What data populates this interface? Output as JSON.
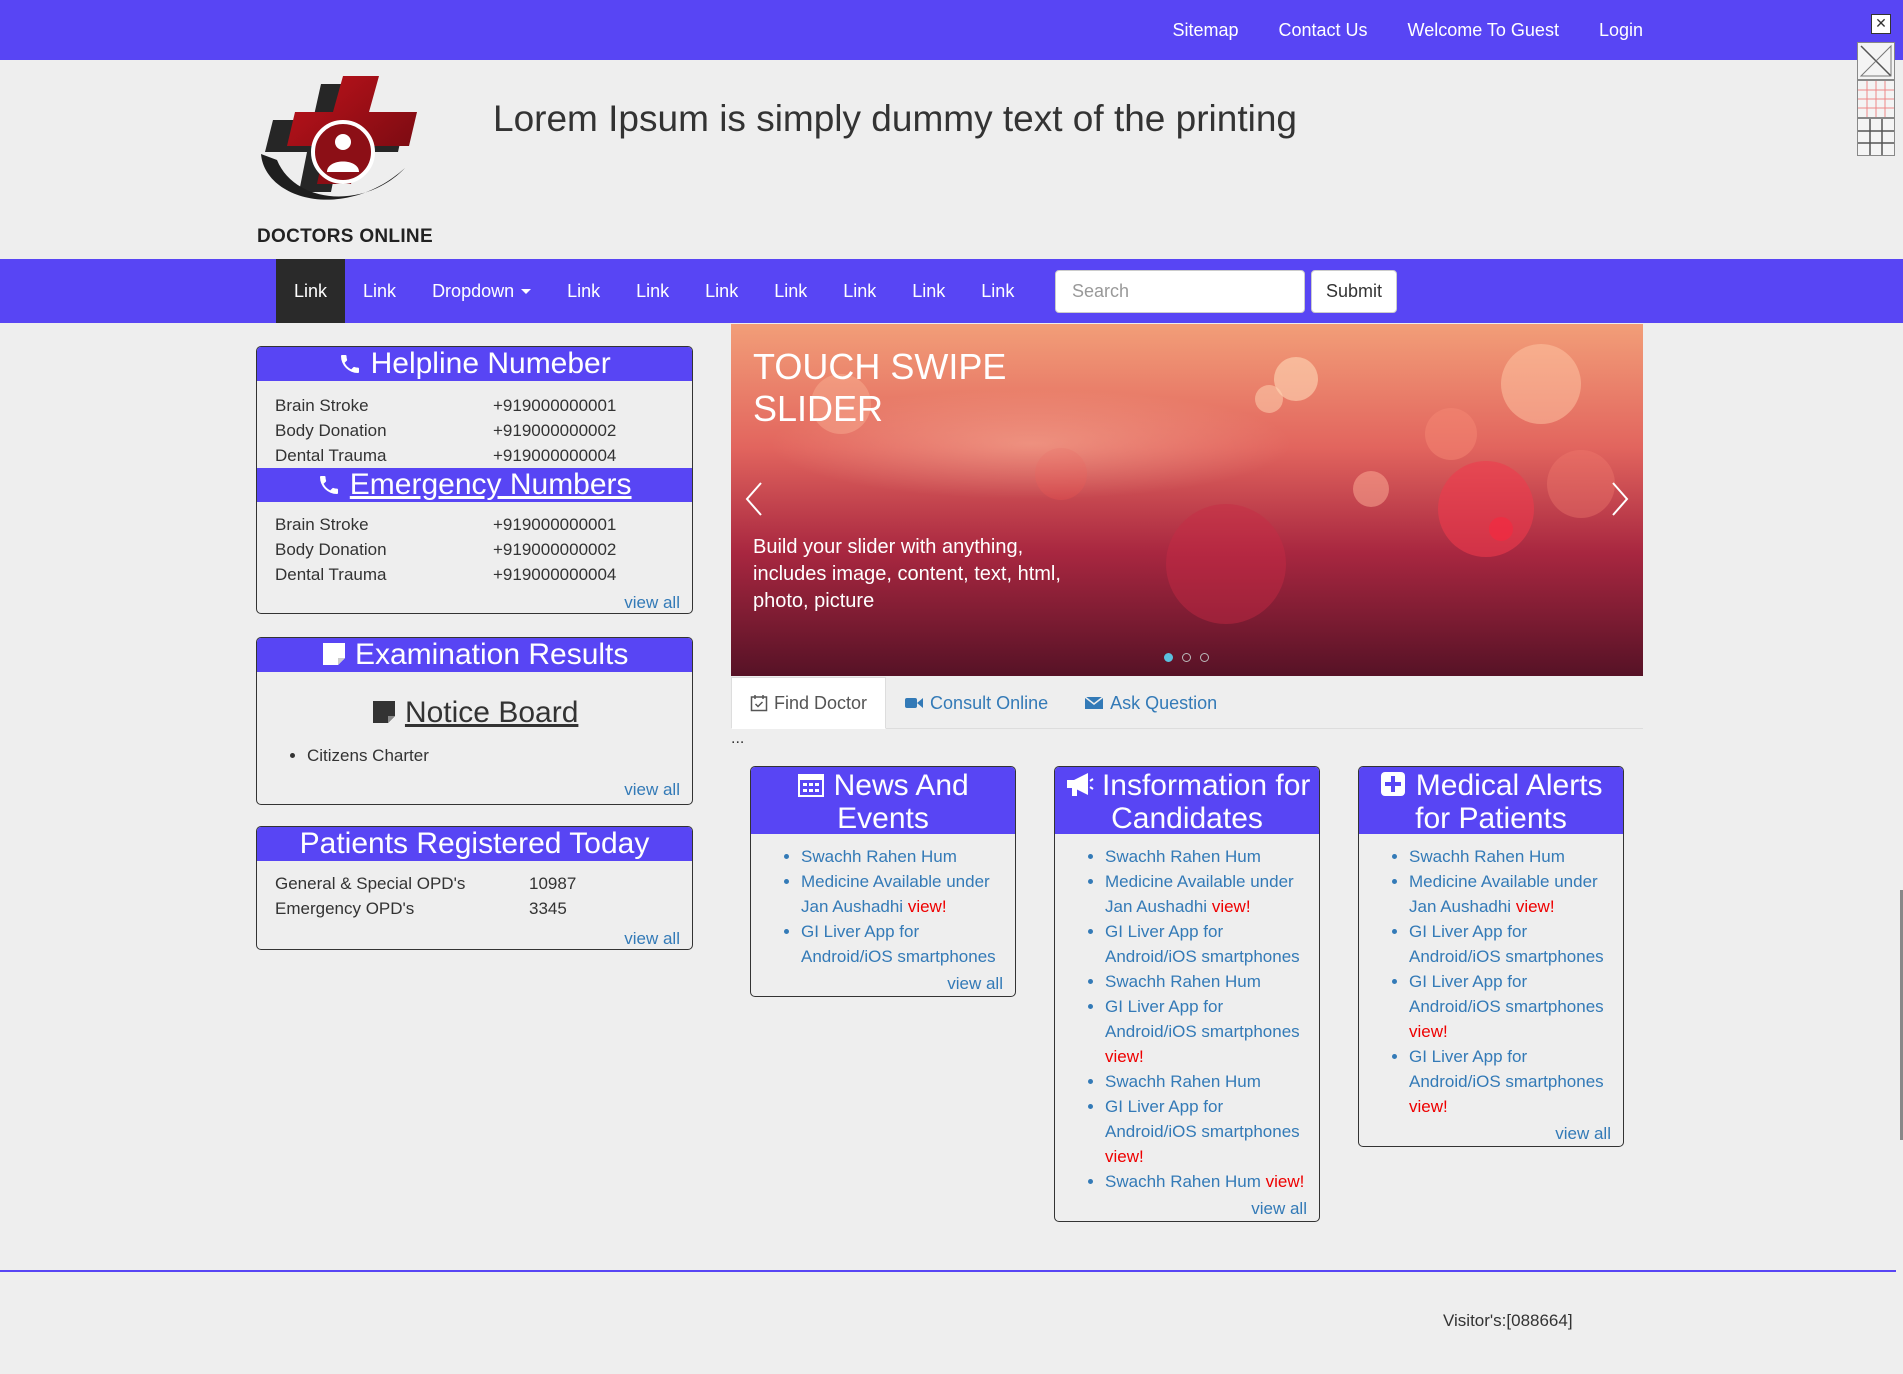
{
  "topbar": {
    "links": [
      "Sitemap",
      "Contact Us",
      "Welcome To Guest",
      "Login"
    ]
  },
  "header": {
    "logo_text": "DOCTORS ONLINE",
    "tagline": "Lorem Ipsum is simply dummy text of the printing"
  },
  "nav": {
    "items": [
      "Link",
      "Link",
      "Dropdown",
      "Link",
      "Link",
      "Link",
      "Link",
      "Link",
      "Link",
      "Link"
    ],
    "search_placeholder": "Search",
    "submit_label": "Submit"
  },
  "helpline": {
    "title": "Helpline Numeber",
    "rows": [
      {
        "name": "Brain Stroke",
        "number": "+919000000001"
      },
      {
        "name": "Body Donation",
        "number": "+919000000002"
      },
      {
        "name": "Dental Trauma",
        "number": "+919000000004"
      }
    ],
    "emergency_title": "Emergency Numbers",
    "emergency_rows": [
      {
        "name": "Brain Stroke",
        "number": "+919000000001"
      },
      {
        "name": "Body Donation",
        "number": "+919000000002"
      },
      {
        "name": "Dental Trauma",
        "number": "+919000000004"
      }
    ],
    "view_all": "view all"
  },
  "exam": {
    "title": "Examination Results",
    "notice_title": "Notice Board",
    "items": [
      "Citizens Charter"
    ],
    "view_all": "view all"
  },
  "patients": {
    "title": "Patients Registered Today",
    "rows": [
      {
        "name": "General & Special OPD's",
        "count": "10987"
      },
      {
        "name": "Emergency OPD's",
        "count": "3345"
      }
    ],
    "view_all": "view all"
  },
  "slider": {
    "title": "TOUCH SWIPE SLIDER",
    "text": "Build your slider with anything, includes image, content, text, html, photo, picture",
    "slide_count": 3,
    "active_slide": 1
  },
  "tabs": {
    "items": [
      "Find Doctor",
      "Consult Online",
      "Ask Question"
    ],
    "after": "..."
  },
  "news": {
    "title": "News And Events",
    "items": [
      {
        "text": "Swachh Rahen Hum",
        "view": ""
      },
      {
        "text": "Medicine Available under Jan Aushadhi",
        "view": "view!"
      },
      {
        "text": "GI Liver App for Android/iOS smartphones",
        "view": ""
      }
    ],
    "view_all": "view all"
  },
  "info": {
    "title": "Insformation for Candidates",
    "items": [
      {
        "text": "Swachh Rahen Hum",
        "view": ""
      },
      {
        "text": "Medicine Available under Jan Aushadhi",
        "view": "view!"
      },
      {
        "text": "GI Liver App for Android/iOS smartphones",
        "view": ""
      },
      {
        "text": "Swachh Rahen Hum",
        "view": ""
      },
      {
        "text": "GI Liver App for Android/iOS smartphones",
        "view": "view!"
      },
      {
        "text": "Swachh Rahen Hum",
        "view": ""
      },
      {
        "text": "GI Liver App for Android/iOS smartphones",
        "view": "view!"
      },
      {
        "text": "Swachh Rahen Hum",
        "view": "view!"
      }
    ],
    "view_all": "view all"
  },
  "alerts": {
    "title": "Medical Alerts for Patients",
    "items": [
      {
        "text": "Swachh Rahen Hum",
        "view": ""
      },
      {
        "text": "Medicine Available under Jan Aushadhi",
        "view": "view!"
      },
      {
        "text": "GI Liver App for Android/iOS smartphones",
        "view": ""
      },
      {
        "text": "GI Liver App for Android/iOS smartphones",
        "view": "view!"
      },
      {
        "text": "GI Liver App for Android/iOS smartphones",
        "view": "view!"
      }
    ],
    "view_all": "view all"
  },
  "footer": {
    "visitors": "Visitor's:[088664]"
  },
  "colors": {
    "brand": "#5845f4",
    "link": "#337ab7",
    "alert": "#ee0000"
  }
}
